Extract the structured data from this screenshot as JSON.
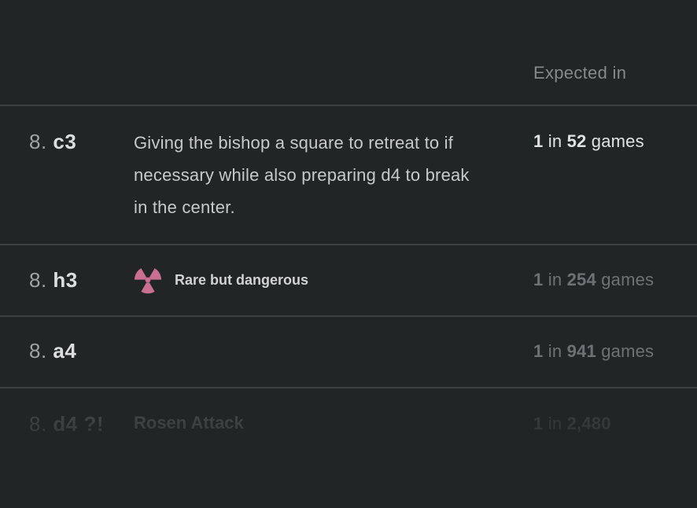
{
  "header": {
    "expected_label": "Expected in"
  },
  "rows": [
    {
      "move_number": "8.",
      "san": "c3",
      "annotation": "",
      "description": "Giving the bishop a square to retreat to if necessary while also preparing d4 to break in the center.",
      "freq_one": "1",
      "freq_in": "in",
      "freq_count": "52",
      "freq_games": "games"
    },
    {
      "move_number": "8.",
      "san": "h3",
      "annotation": "",
      "tag_icon": "radiation-icon",
      "tag_label": "Rare but dangerous",
      "tag_color": "#c96f92",
      "freq_one": "1",
      "freq_in": "in",
      "freq_count": "254",
      "freq_games": "games"
    },
    {
      "move_number": "8.",
      "san": "a4",
      "annotation": "",
      "freq_one": "1",
      "freq_in": "in",
      "freq_count": "941",
      "freq_games": "games"
    },
    {
      "move_number": "8.",
      "san": "d4",
      "annotation": "?!",
      "tag_label": "Rosen Attack",
      "freq_one": "1",
      "freq_in": "in",
      "freq_count": "2,480",
      "freq_games": ""
    }
  ]
}
